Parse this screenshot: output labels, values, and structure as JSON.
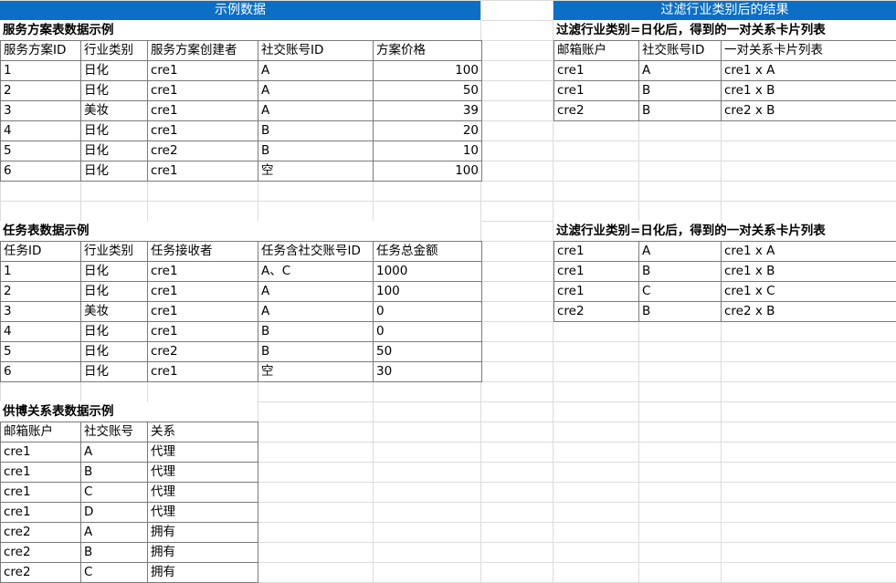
{
  "left_banner": "示例数据",
  "right_banner": "过滤行业类别后的结果",
  "service_table": {
    "title": "服务方案表数据示例",
    "headers": [
      "服务方案ID",
      "行业类别",
      "服务方案创建者",
      "社交账号ID",
      "方案价格"
    ],
    "rows": [
      [
        "1",
        "日化",
        "cre1",
        "A",
        "100"
      ],
      [
        "2",
        "日化",
        "cre1",
        "A",
        "50"
      ],
      [
        "3",
        "美妆",
        "cre1",
        "A",
        "39"
      ],
      [
        "4",
        "日化",
        "cre1",
        "B",
        "20"
      ],
      [
        "5",
        "日化",
        "cre2",
        "B",
        "10"
      ],
      [
        "6",
        "日化",
        "cre1",
        "空",
        "100"
      ]
    ]
  },
  "task_table": {
    "title": "任务表数据示例",
    "headers": [
      "任务ID",
      "行业类别",
      "任务接收者",
      "任务含社交账号ID",
      "任务总金额"
    ],
    "rows": [
      [
        "1",
        "日化",
        "cre1",
        "A、C",
        "1000"
      ],
      [
        "2",
        "日化",
        "cre1",
        "A",
        "100"
      ],
      [
        "3",
        "美妆",
        "cre1",
        "A",
        "0"
      ],
      [
        "4",
        "日化",
        "cre1",
        "B",
        "0"
      ],
      [
        "5",
        "日化",
        "cre2",
        "B",
        "50"
      ],
      [
        "6",
        "日化",
        "cre1",
        "空",
        "30"
      ]
    ]
  },
  "supply_table": {
    "title": "供博关系表数据示例",
    "headers": [
      "邮箱账户",
      "社交账号",
      "关系"
    ],
    "rows": [
      [
        "cre1",
        "A",
        "代理"
      ],
      [
        "cre1",
        "B",
        "代理"
      ],
      [
        "cre1",
        "C",
        "代理"
      ],
      [
        "cre1",
        "D",
        "代理"
      ],
      [
        "cre2",
        "A",
        "拥有"
      ],
      [
        "cre2",
        "B",
        "拥有"
      ],
      [
        "cre2",
        "C",
        "拥有"
      ]
    ]
  },
  "result_table_1": {
    "title": "过滤行业类别=日化后，得到的一对关系卡片列表",
    "headers": [
      "邮箱账户",
      "社交账号ID",
      "一对关系卡片列表"
    ],
    "rows": [
      [
        "cre1",
        "A",
        "cre1  x A"
      ],
      [
        "cre1",
        "B",
        "cre1  x B"
      ],
      [
        "cre2",
        "B",
        "cre2  x B"
      ]
    ]
  },
  "result_table_2": {
    "title": "过滤行业类别=日化后，得到的一对关系卡片列表",
    "rows": [
      [
        "cre1",
        "A",
        "cre1 x A"
      ],
      [
        "cre1",
        "B",
        "cre1 x B"
      ],
      [
        "cre1",
        "C",
        "cre1 x C"
      ],
      [
        "cre2",
        "B",
        "cre2 x B"
      ]
    ]
  }
}
